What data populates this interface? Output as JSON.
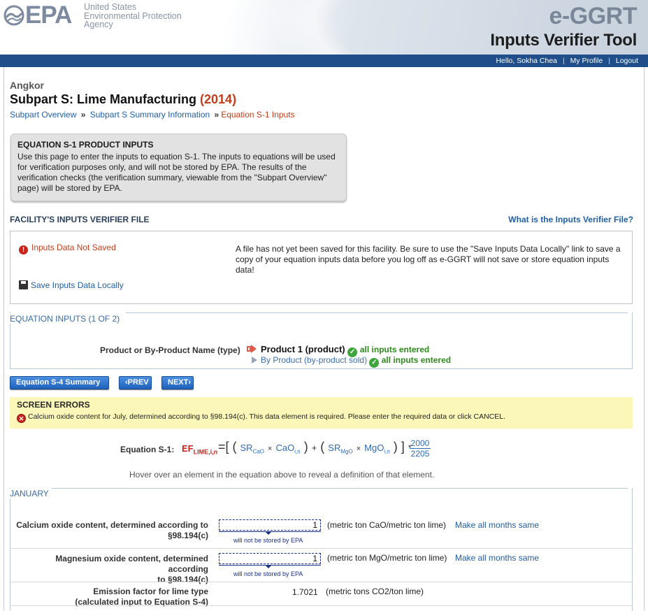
{
  "header": {
    "logo_text": "EPA",
    "agency_line1": "United States",
    "agency_line2": "Environmental Protection",
    "agency_line3": "Agency",
    "app_name": "e-GGRT",
    "app_subtitle": "Inputs Verifier Tool"
  },
  "userbar": {
    "greeting": "Hello, Sokha Chea",
    "profile": "My Profile",
    "logout": "Logout"
  },
  "page": {
    "facility": "Angkor",
    "subpart_title": "Subpart S: Lime Manufacturing",
    "year": "(2014)",
    "breadcrumb": {
      "item1": "Subpart Overview",
      "item2": "Subpart S Summary Information",
      "current": "Equation S-1 Inputs",
      "sep": "»"
    }
  },
  "infobox": {
    "title": "EQUATION S-1 PRODUCT INPUTS",
    "text": "Use this page to enter the inputs to equation S-1. The inputs to equations will be used for verification purposes only, and will not be stored by EPA. The results of the verification checks (the verification summary, viewable from the \"Subpart Overview\" page) will be stored by EPA."
  },
  "file_section": {
    "heading": "FACILITY'S INPUTS VERIFIER FILE",
    "help_link": "What is the Inputs Verifier File?",
    "status": "Inputs Data Not Saved",
    "save_link": "Save Inputs Data Locally",
    "message": "A file has not yet been saved for this facility. Be sure to use the \"Save Inputs Data Locally\" link to save a copy of your equation inputs data before you log off as e-GGRT will not save or store equation inputs data!"
  },
  "equation_inputs": {
    "heading": "EQUATION INPUTS (1 OF 2)",
    "product_label": "Product or By-Product Name (type)",
    "product1": "Product 1 (product)",
    "product1_status": "all inputs entered",
    "byproduct": "By Product (by-product sold)",
    "byproduct_status": "all inputs entered"
  },
  "buttons": {
    "summary": "Equation S-4 Summary",
    "prev": "PREV",
    "next": "NEXT"
  },
  "screen_errors": {
    "title": "SCREEN ERRORS",
    "message": "Calcium oxide content for July, determined according to §98.194(c). This data element is required. Please enter the required data or click CANCEL."
  },
  "equation": {
    "label": "Equation S-1:",
    "ef": "EF",
    "ef_sub": "LIME,i,n",
    "sr_cao": "SR",
    "sr_cao_sub": "CaO",
    "cao": "CaO",
    "cao_sub": "i,n",
    "sr_mgo": "SR",
    "sr_mgo_sub": "MgO",
    "mgo": "MgO",
    "mgo_sub": "i,n",
    "frac_num": "2000",
    "frac_den": "2205",
    "hover_note": "Hover over an element in the equation above to reveal a definition of that element."
  },
  "month": {
    "name": "JANUARY",
    "rows": [
      {
        "label_line1": "Calcium oxide content, determined according to",
        "label_line2": "§98.194(c)",
        "value": "1",
        "note": "will not be stored by EPA",
        "unit": "(metric ton CaO/metric ton lime)",
        "link": "Make all months same"
      },
      {
        "label_line1": "Magnesium oxide content, determined according",
        "label_line2": "to §98.194(c)",
        "value": "1",
        "note": "will not be stored by EPA",
        "unit": "(metric ton MgO/metric ton lime)",
        "link": "Make all months same"
      },
      {
        "label_line1": "Emission factor for lime type",
        "label_line2": "(calculated input to Equation S-4)",
        "value": "1.7021",
        "unit": "(metric tons CO2/ton lime)"
      }
    ]
  },
  "colors": {
    "brand_blue": "#1f4e8a",
    "link_blue": "#1f5fa6",
    "error_red": "#c33d1b",
    "success_green": "#2e8a1c",
    "warning_bg": "#fbf7b9"
  }
}
